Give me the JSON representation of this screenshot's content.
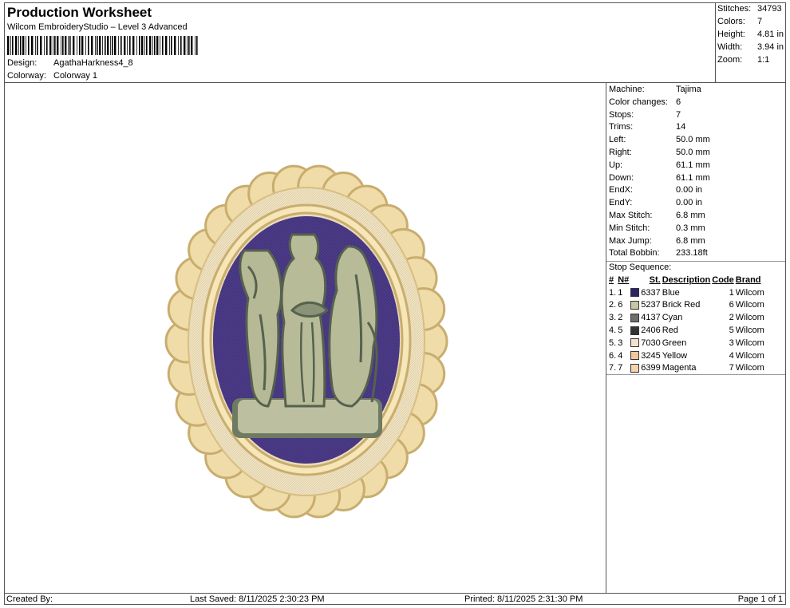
{
  "header": {
    "title": "Production Worksheet",
    "subtitle": "Wilcom EmbroideryStudio – Level 3 Advanced",
    "design_label": "Design:",
    "design_value": "AgathaHarkness4_8",
    "colorway_label": "Colorway:",
    "colorway_value": "Colorway 1"
  },
  "summary": {
    "stitches_label": "Stitches:",
    "stitches_value": "34793",
    "colors_label": "Colors:",
    "colors_value": "7",
    "height_label": "Height:",
    "height_value": "4.81 in",
    "width_label": "Width:",
    "width_value": "3.94 in",
    "zoom_label": "Zoom:",
    "zoom_value": "1:1"
  },
  "machine_info": [
    {
      "label": "Machine:",
      "value": "Tajima"
    },
    {
      "label": "Color changes:",
      "value": "6"
    },
    {
      "label": "Stops:",
      "value": "7"
    },
    {
      "label": "Trims:",
      "value": "14"
    },
    {
      "label": "Left:",
      "value": "50.0 mm"
    },
    {
      "label": "Right:",
      "value": "50.0 mm"
    },
    {
      "label": "Up:",
      "value": "61.1 mm"
    },
    {
      "label": "Down:",
      "value": "61.1 mm"
    },
    {
      "label": "EndX:",
      "value": "0.00 in"
    },
    {
      "label": "EndY:",
      "value": "0.00 in"
    },
    {
      "label": "Max Stitch:",
      "value": "6.8 mm"
    },
    {
      "label": "Min Stitch:",
      "value": "0.3 mm"
    },
    {
      "label": "Max Jump:",
      "value": "6.8 mm"
    },
    {
      "label": "Total Bobbin:",
      "value": "233.18ft"
    }
  ],
  "stop_sequence": {
    "title": "Stop Sequence:",
    "headers": {
      "num": "#",
      "n": "N#",
      "st": "St.",
      "description": "Description",
      "code": "Code",
      "brand": "Brand"
    },
    "rows": [
      {
        "num": "1.",
        "n": "1",
        "st": "6337",
        "description": "Blue",
        "code": "1",
        "brand": "Wilcom",
        "color": "#2b2566"
      },
      {
        "num": "2.",
        "n": "6",
        "st": "5237",
        "description": "Brick Red",
        "code": "6",
        "brand": "Wilcom",
        "color": "#c9c6a6"
      },
      {
        "num": "3.",
        "n": "2",
        "st": "4137",
        "description": "Cyan",
        "code": "2",
        "brand": "Wilcom",
        "color": "#6e6e6e"
      },
      {
        "num": "4.",
        "n": "5",
        "st": "2406",
        "description": "Red",
        "code": "5",
        "brand": "Wilcom",
        "color": "#333333"
      },
      {
        "num": "5.",
        "n": "3",
        "st": "7030",
        "description": "Green",
        "code": "3",
        "brand": "Wilcom",
        "color": "#f4e1d0"
      },
      {
        "num": "6.",
        "n": "4",
        "st": "3245",
        "description": "Yellow",
        "code": "4",
        "brand": "Wilcom",
        "color": "#f3c69c"
      },
      {
        "num": "7.",
        "n": "7",
        "st": "6399",
        "description": "Magenta",
        "code": "7",
        "brand": "Wilcom",
        "color": "#f6d2ad"
      }
    ]
  },
  "footer": {
    "created_by": "Created By:",
    "last_saved": "Last Saved: 8/11/2025 2:30:23 PM",
    "printed": "Printed: 8/11/2025 2:31:30 PM",
    "page": "Page 1 of 1"
  },
  "design_colors": {
    "border_cream": "#f0dca8",
    "border_dark": "#c8ad6e",
    "field_purple": "#4b3a86",
    "figure_light": "#b7bb98",
    "figure_dark": "#5e6a55"
  }
}
